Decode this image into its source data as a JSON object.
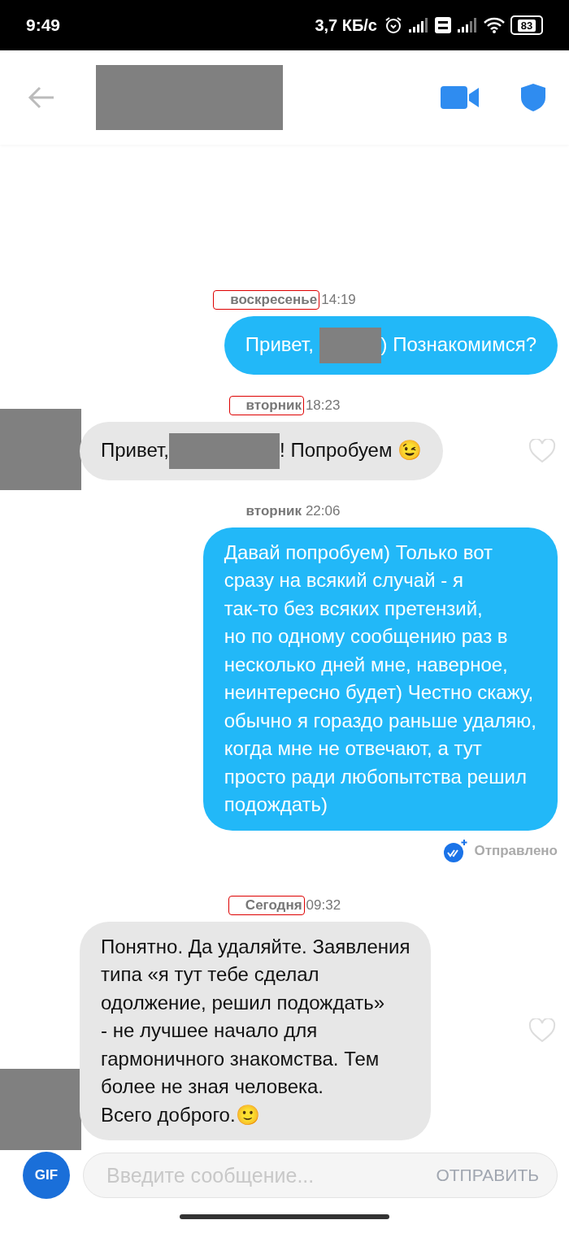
{
  "status_bar": {
    "time": "9:49",
    "speed": "3,7 КБ/с",
    "battery": "83"
  },
  "header": {
    "title_redacted": true
  },
  "messages": [
    {
      "kind": "outgoing",
      "day": "воскресенье",
      "day_highlighted": true,
      "time": "14:19",
      "parts": [
        {
          "kind": "text",
          "text": "Привет, "
        },
        {
          "kind": "redacted"
        },
        {
          "kind": "text",
          "text": ") Познакомимся?"
        }
      ]
    },
    {
      "kind": "incoming",
      "day": "вторник",
      "day_highlighted": true,
      "time": "18:23",
      "parts": [
        {
          "kind": "text",
          "text": "Привет,"
        },
        {
          "kind": "redacted"
        },
        {
          "kind": "text",
          "text": "! Попробуем 😉"
        }
      ]
    },
    {
      "kind": "outgoing",
      "day": "вторник",
      "day_highlighted": false,
      "time": "22:06",
      "status": "Отправлено",
      "parts": [
        {
          "kind": "text",
          "text": "Давай попробуем) Только вот\nсразу на всякий случай - я\nтак-то без всяких претензий,\nно по одному сообщению раз в\nнесколько дней мне, наверное,\nнеинтересно будет) Честно скажу,\nобычно я гораздо раньше удаляю,\nкогда мне не отвечают, а тут\nпросто ради любопытства решил\nподождать)"
        }
      ]
    },
    {
      "kind": "incoming",
      "day": "Сегодня",
      "day_highlighted": true,
      "time": "09:32",
      "parts": [
        {
          "kind": "text",
          "text": "Понятно. Да удаляйте. Заявления\nтипа «я тут тебе сделал\nодолжение, решил подождать»\n- не лучшее начало для\nгармоничного знакомства. Тем\nболее не зная человека.\nВсего доброго.🙂"
        }
      ]
    }
  ],
  "composer": {
    "gif_label": "GIF",
    "placeholder": "Введите сообщение...",
    "send_label": "ОТПРАВИТЬ"
  }
}
